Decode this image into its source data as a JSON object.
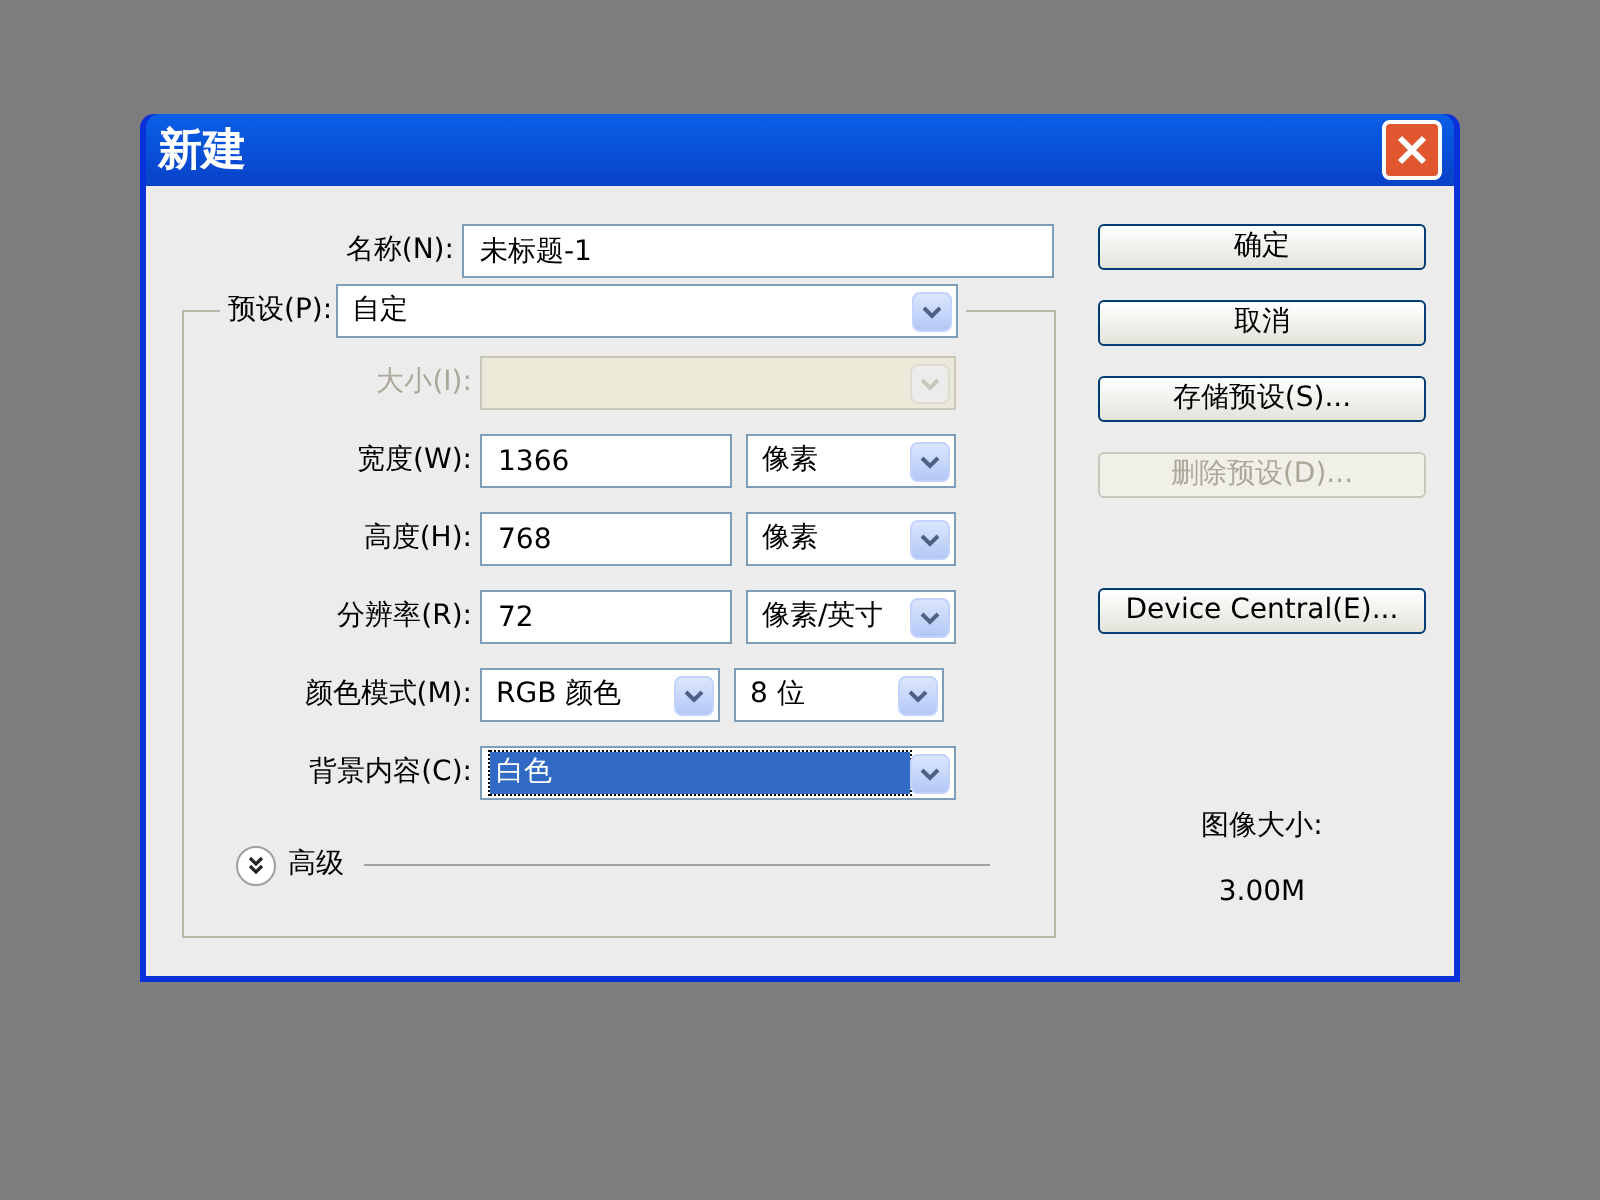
{
  "window": {
    "title": "新建"
  },
  "name_field": {
    "label": "名称(N):",
    "value": "未标题-1"
  },
  "preset": {
    "label": "预设(P):",
    "value": "自定"
  },
  "rows": [
    {
      "label": "大小(I):",
      "disabled": true,
      "controls": [
        {
          "kind": "combo"
        }
      ]
    },
    {
      "label": "宽度(W):",
      "disabled": false,
      "controls": [
        {
          "kind": "text",
          "value": "1366"
        },
        {
          "kind": "combo",
          "value": "像素"
        }
      ]
    },
    {
      "label": "高度(H):",
      "disabled": false,
      "controls": [
        {
          "kind": "text",
          "value": "768"
        },
        {
          "kind": "combo",
          "value": "像素"
        }
      ]
    },
    {
      "label": "分辨率(R):",
      "disabled": false,
      "controls": [
        {
          "kind": "text",
          "value": "72"
        },
        {
          "kind": "combo",
          "value": "像素/英寸"
        }
      ]
    },
    {
      "label": "颜色模式(M):",
      "disabled": false,
      "controls": [
        {
          "kind": "combo",
          "value": "RGB 颜色"
        },
        {
          "kind": "combo",
          "value": "8 位"
        }
      ]
    },
    {
      "label": "背景内容(C):",
      "disabled": false,
      "controls": [
        {
          "kind": "combo",
          "value": "白色",
          "focused": true
        }
      ]
    }
  ],
  "advanced": {
    "label": "高级",
    "expanded": false
  },
  "buttons": [
    {
      "label": "确定",
      "disabled": false
    },
    {
      "label": "取消",
      "disabled": false
    },
    {
      "label": "存储预设(S)...",
      "disabled": false
    },
    {
      "label": "删除预设(D)...",
      "disabled": true
    },
    {
      "label": "Device Central(E)...",
      "disabled": false
    }
  ],
  "image_size": {
    "label": "图像大小:",
    "value": "3.00M"
  }
}
